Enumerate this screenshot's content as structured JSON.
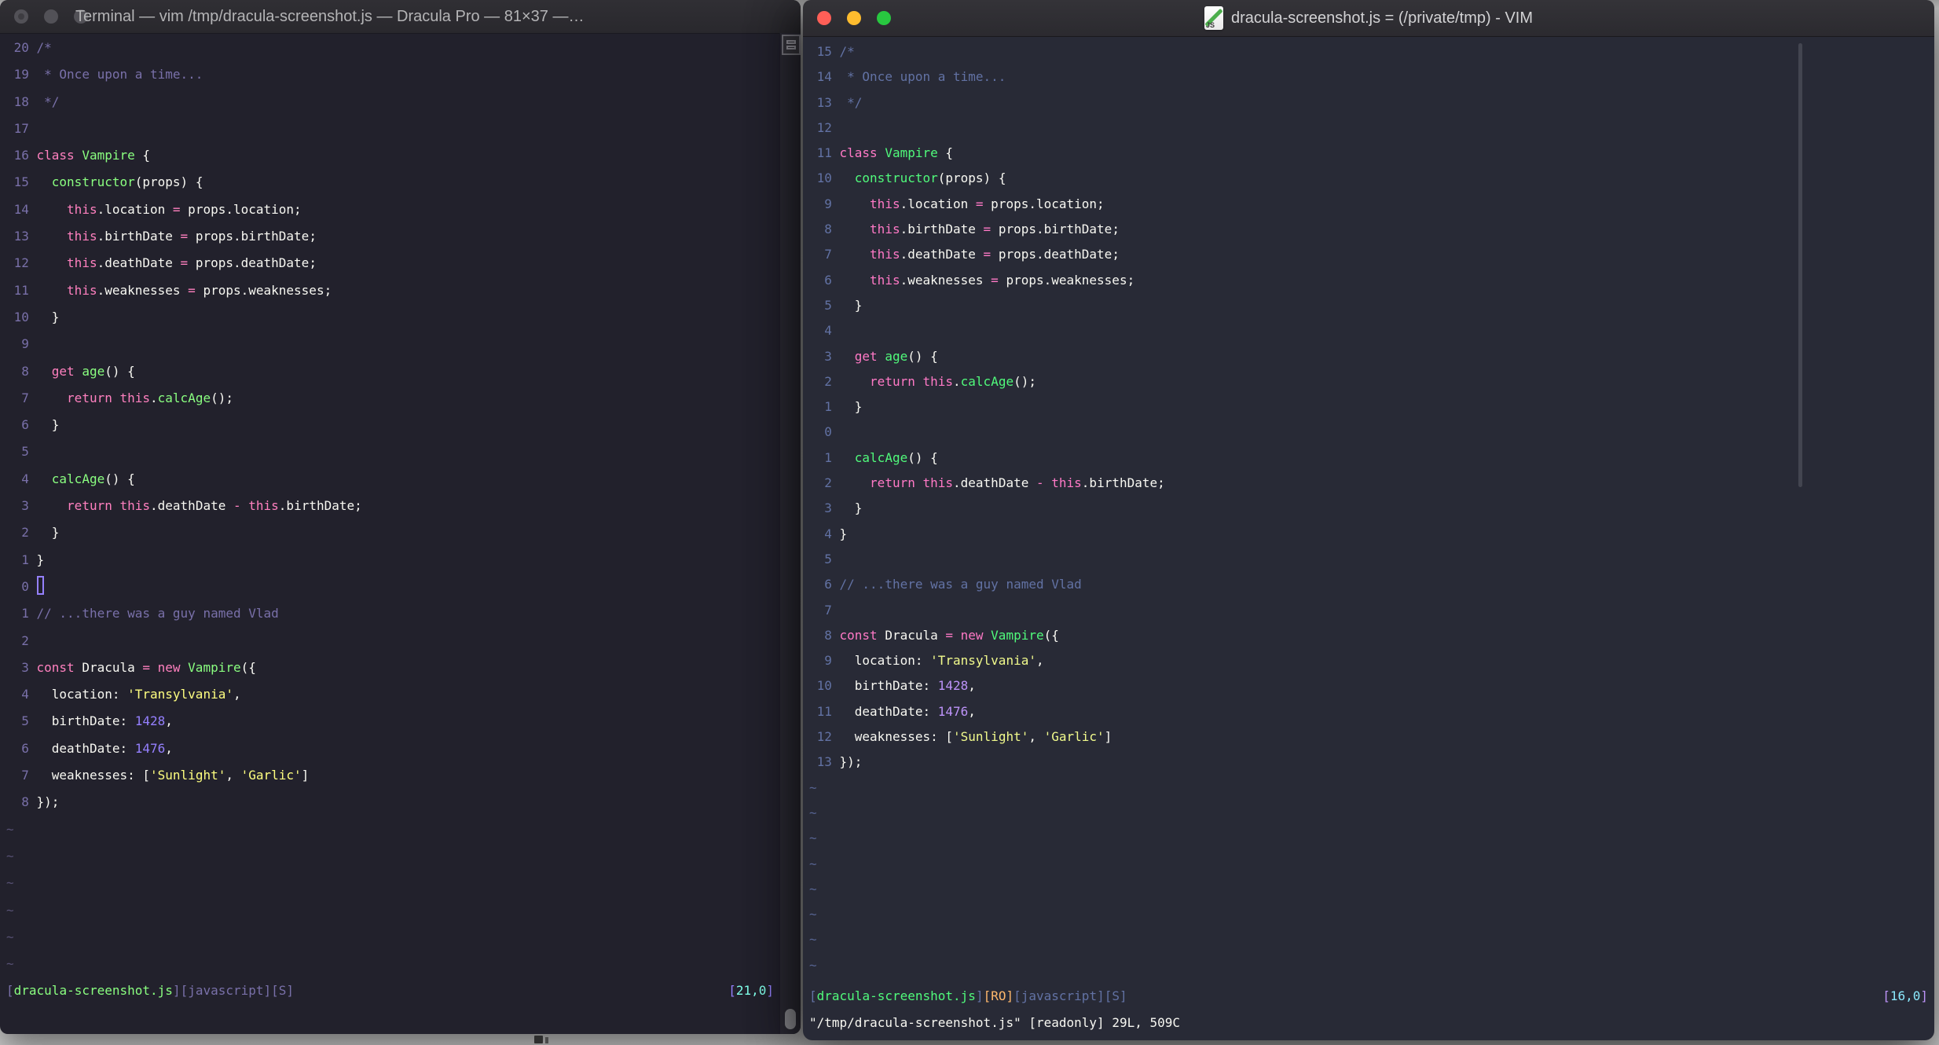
{
  "shared": {
    "tilde_char": "~",
    "code_lines": [
      [
        [
          "comment",
          "/*"
        ]
      ],
      [
        [
          "comment",
          " * Once upon a time..."
        ]
      ],
      [
        [
          "comment",
          " */"
        ]
      ],
      [],
      [
        [
          "pink",
          "class "
        ],
        [
          "green",
          "Vampire"
        ],
        [
          "fg",
          " {"
        ]
      ],
      [
        [
          "fg",
          "  "
        ],
        [
          "green",
          "constructor"
        ],
        [
          "fg",
          "(props) {"
        ]
      ],
      [
        [
          "fg",
          "    "
        ],
        [
          "pink",
          "this"
        ],
        [
          "fg",
          ".location "
        ],
        [
          "pink",
          "="
        ],
        [
          "fg",
          " props.location;"
        ]
      ],
      [
        [
          "fg",
          "    "
        ],
        [
          "pink",
          "this"
        ],
        [
          "fg",
          ".birthDate "
        ],
        [
          "pink",
          "="
        ],
        [
          "fg",
          " props.birthDate;"
        ]
      ],
      [
        [
          "fg",
          "    "
        ],
        [
          "pink",
          "this"
        ],
        [
          "fg",
          ".deathDate "
        ],
        [
          "pink",
          "="
        ],
        [
          "fg",
          " props.deathDate;"
        ]
      ],
      [
        [
          "fg",
          "    "
        ],
        [
          "pink",
          "this"
        ],
        [
          "fg",
          ".weaknesses "
        ],
        [
          "pink",
          "="
        ],
        [
          "fg",
          " props.weaknesses;"
        ]
      ],
      [
        [
          "fg",
          "  }"
        ]
      ],
      [],
      [
        [
          "fg",
          "  "
        ],
        [
          "pink",
          "get "
        ],
        [
          "green",
          "age"
        ],
        [
          "fg",
          "() {"
        ]
      ],
      [
        [
          "fg",
          "    "
        ],
        [
          "pink",
          "return this"
        ],
        [
          "fg",
          "."
        ],
        [
          "green",
          "calcAge"
        ],
        [
          "fg",
          "();"
        ]
      ],
      [
        [
          "fg",
          "  }"
        ]
      ],
      [],
      [
        [
          "fg",
          "  "
        ],
        [
          "green",
          "calcAge"
        ],
        [
          "fg",
          "() {"
        ]
      ],
      [
        [
          "fg",
          "    "
        ],
        [
          "pink",
          "return this"
        ],
        [
          "fg",
          ".deathDate "
        ],
        [
          "pink",
          "-"
        ],
        [
          "fg",
          " "
        ],
        [
          "pink",
          "this"
        ],
        [
          "fg",
          ".birthDate;"
        ]
      ],
      [
        [
          "fg",
          "  }"
        ]
      ],
      [
        [
          "fg",
          "}"
        ]
      ],
      [],
      [
        [
          "comment",
          "// ...there was a guy named Vlad"
        ]
      ],
      [],
      [
        [
          "pink",
          "const "
        ],
        [
          "fg",
          "Dracula "
        ],
        [
          "pink",
          "= new "
        ],
        [
          "green",
          "Vampire"
        ],
        [
          "fg",
          "({"
        ]
      ],
      [
        [
          "fg",
          "  location: "
        ],
        [
          "yellow",
          "'Transylvania'"
        ],
        [
          "fg",
          ","
        ]
      ],
      [
        [
          "fg",
          "  birthDate: "
        ],
        [
          "num",
          "1428"
        ],
        [
          "fg",
          ","
        ]
      ],
      [
        [
          "fg",
          "  deathDate: "
        ],
        [
          "num",
          "1476"
        ],
        [
          "fg",
          ","
        ]
      ],
      [
        [
          "fg",
          "  weaknesses: ["
        ],
        [
          "yellow",
          "'Sunlight'"
        ],
        [
          "fg",
          ", "
        ],
        [
          "yellow",
          "'Garlic'"
        ],
        [
          "fg",
          "]"
        ]
      ],
      [
        [
          "fg",
          "});"
        ]
      ]
    ]
  },
  "left_window": {
    "app": "Terminal",
    "title": "Terminal — vim /tmp/dracula-screenshot.js — Dracula Pro — 81×37 —…",
    "traffic_lights": [
      "#525157",
      "#525157",
      "#525157"
    ],
    "gutters": [
      "20",
      "19",
      "18",
      "17",
      "16",
      "15",
      "14",
      "13",
      "12",
      "11",
      "10",
      "9",
      "8",
      "7",
      "6",
      "5",
      "4",
      "3",
      "2",
      "1",
      "0",
      "1",
      "2",
      "3",
      "4",
      "5",
      "6",
      "7",
      "8"
    ],
    "cursor_row": 20,
    "cursor_style": "hollow",
    "tilde_count": 6,
    "status_left": [
      [
        "comment",
        "["
      ],
      [
        "green",
        "dracula-screenshot.js"
      ],
      [
        "comment",
        "][javascript][S]"
      ]
    ],
    "status_right": [
      [
        "num",
        "["
      ],
      [
        "cyan",
        "21,0"
      ],
      [
        "num",
        "]"
      ]
    ],
    "command_line": [],
    "palette": {
      "bg": "#22212C",
      "fg": "#F8F8F2",
      "comment": "#7970A9",
      "pink": "#FF80BF",
      "green": "#8AFF80",
      "num": "#9580FF",
      "yellow": "#FFFF80",
      "cyan": "#80FFEA",
      "orange": "#FFCA80",
      "lnum": "#7970A9",
      "tilde": "#565073"
    }
  },
  "right_window": {
    "app": "MacVim",
    "title": "dracula-screenshot.js = (/private/tmp) - VIM",
    "file_icon_label": "JS",
    "traffic_lights": [
      "#FF5F57",
      "#FEBC2E",
      "#28C840"
    ],
    "gutters": [
      "15",
      "14",
      "13",
      "12",
      "11",
      "10",
      "9",
      "8",
      "7",
      "6",
      "5",
      "4",
      "3",
      "2",
      "1",
      "0",
      "1",
      "2",
      "3",
      "4",
      "5",
      "6",
      "7",
      "8",
      "9",
      "10",
      "11",
      "12",
      "13"
    ],
    "cursor_row": 15,
    "cursor_style": "none",
    "tilde_count": 8,
    "status_left": [
      [
        "comment",
        "["
      ],
      [
        "green",
        "dracula-screenshot.js"
      ],
      [
        "comment",
        "]"
      ],
      [
        "orange",
        "[RO]"
      ],
      [
        "comment",
        "[javascript][S]"
      ]
    ],
    "status_right": [
      [
        "num",
        "["
      ],
      [
        "cyan",
        "16,0"
      ],
      [
        "num",
        "]"
      ]
    ],
    "command_line": [
      [
        "fg",
        "\"/tmp/dracula-screenshot.js\" [readonly] 29L, 509C"
      ]
    ],
    "palette": {
      "bg": "#282A36",
      "fg": "#F8F8F2",
      "comment": "#6272A4",
      "pink": "#FF79C6",
      "green": "#50FA7B",
      "num": "#BD93F9",
      "yellow": "#F1FA8C",
      "cyan": "#8BE9FD",
      "orange": "#FFB86C",
      "lnum": "#6272A4",
      "tilde": "#566391"
    }
  }
}
